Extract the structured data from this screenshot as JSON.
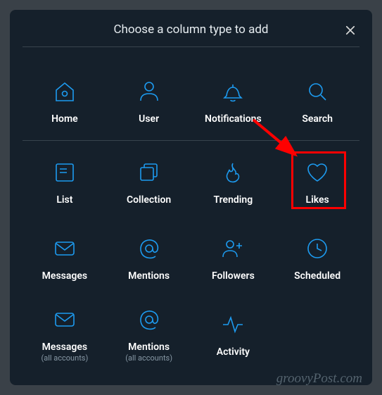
{
  "header": {
    "title": "Choose a column type to add"
  },
  "items": [
    {
      "label": "Home",
      "sublabel": ""
    },
    {
      "label": "User",
      "sublabel": ""
    },
    {
      "label": "Notifications",
      "sublabel": ""
    },
    {
      "label": "Search",
      "sublabel": ""
    },
    {
      "label": "List",
      "sublabel": ""
    },
    {
      "label": "Collection",
      "sublabel": ""
    },
    {
      "label": "Trending",
      "sublabel": ""
    },
    {
      "label": "Likes",
      "sublabel": ""
    },
    {
      "label": "Messages",
      "sublabel": ""
    },
    {
      "label": "Mentions",
      "sublabel": ""
    },
    {
      "label": "Followers",
      "sublabel": ""
    },
    {
      "label": "Scheduled",
      "sublabel": ""
    },
    {
      "label": "Messages",
      "sublabel": "(all accounts)"
    },
    {
      "label": "Mentions",
      "sublabel": "(all accounts)"
    },
    {
      "label": "Activity",
      "sublabel": ""
    }
  ],
  "watermark": "groovyPost.com",
  "colors": {
    "accent": "#1d9bf0",
    "bg": "#15202b",
    "highlight": "#ff0000"
  }
}
